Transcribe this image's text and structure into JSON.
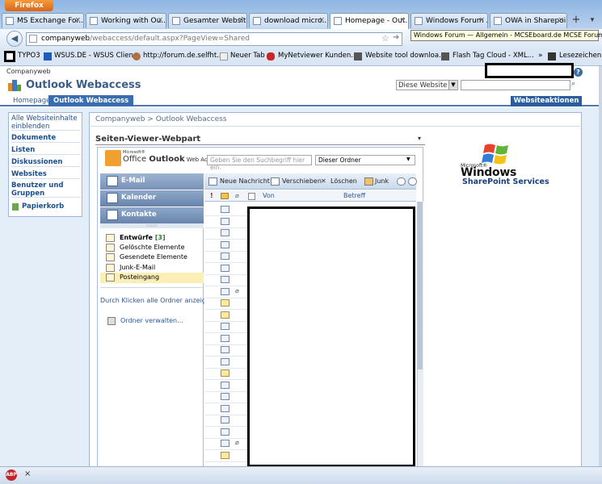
{
  "browser": {
    "app_button": "Firefox",
    "tabs": [
      {
        "label": "MS Exchange For..."
      },
      {
        "label": "Working with Ou..."
      },
      {
        "label": "Gesamter Websit..."
      },
      {
        "label": "download micro..."
      },
      {
        "label": "Homepage - Out..."
      },
      {
        "label": "Windows Forum ..."
      },
      {
        "label": "OWA in Sharepoi..."
      }
    ],
    "tooltip": "Windows Forum — Allgemein - MCSEboard.de MCSE Forum",
    "url_host": "companyweb",
    "url_path": "/webaccess/default.aspx?PageView=Shared",
    "bookmarks": [
      {
        "label": "TYPO3"
      },
      {
        "label": "WSUS.DE - WSUS Clien..."
      },
      {
        "label": "http://forum.de.selfht..."
      },
      {
        "label": "Neuer Tab"
      },
      {
        "label": "MyNetviewer Kunden..."
      },
      {
        "label": "Website tool downloa..."
      },
      {
        "label": "Flash Tag Cloud - XML..."
      },
      {
        "label": "Lesezeichen"
      }
    ],
    "bookmarks_more": "»"
  },
  "sharepoint": {
    "breadcrumb_top": "Companyweb",
    "site_title": "Outlook Webaccess",
    "search_scope": "Diese Website",
    "top_tabs": [
      {
        "label": "Homepage"
      },
      {
        "label": "Outlook Webaccess"
      }
    ],
    "site_actions": "Websiteaktionen ▾",
    "quick_launch": [
      {
        "label": "Alle Websiteinhalte einblenden"
      },
      {
        "label": "Dokumente"
      },
      {
        "label": "Listen"
      },
      {
        "label": "Diskussionen"
      },
      {
        "label": "Websites"
      },
      {
        "label": "Benutzer und Gruppen"
      },
      {
        "label": "Papierkorb"
      }
    ],
    "content_breadcrumb": "Companyweb > Outlook Webaccess",
    "webpart_title": "Seiten-Viewer-Webpart",
    "webpart_menu": "▾"
  },
  "owa": {
    "logo_ms": "Microsoft®",
    "logo_name_a": "Office ",
    "logo_name_b": "Outlook",
    "logo_web": " Web Access",
    "search_placeholder": "Geben Sie den Suchbegriff hier ein.",
    "folder_scope": "Dieser Ordner",
    "nav": [
      {
        "label": "E-Mail"
      },
      {
        "label": "Kalender"
      },
      {
        "label": "Kontakte"
      }
    ],
    "folders": [
      {
        "label": "Entwürfe",
        "count": "[3]"
      },
      {
        "label": "Gelöschte Elemente"
      },
      {
        "label": "Gesendete Elemente"
      },
      {
        "label": "Junk-E-Mail"
      },
      {
        "label": "Posteingang"
      }
    ],
    "show_all": "Durch Klicken alle Ordner anzeigen",
    "manage_folders": "Ordner verwalten...",
    "toolbar": [
      {
        "label": "Neue Nachricht"
      },
      {
        "label": "Verschieben"
      },
      {
        "label": "Löschen"
      },
      {
        "label": "Junk"
      }
    ],
    "columns": {
      "importance": "!",
      "from": "Von",
      "subject": "Betreff"
    }
  },
  "branding": {
    "ms": "Microsoft®",
    "windows": "Windows",
    "product": "SharePoint Services"
  }
}
